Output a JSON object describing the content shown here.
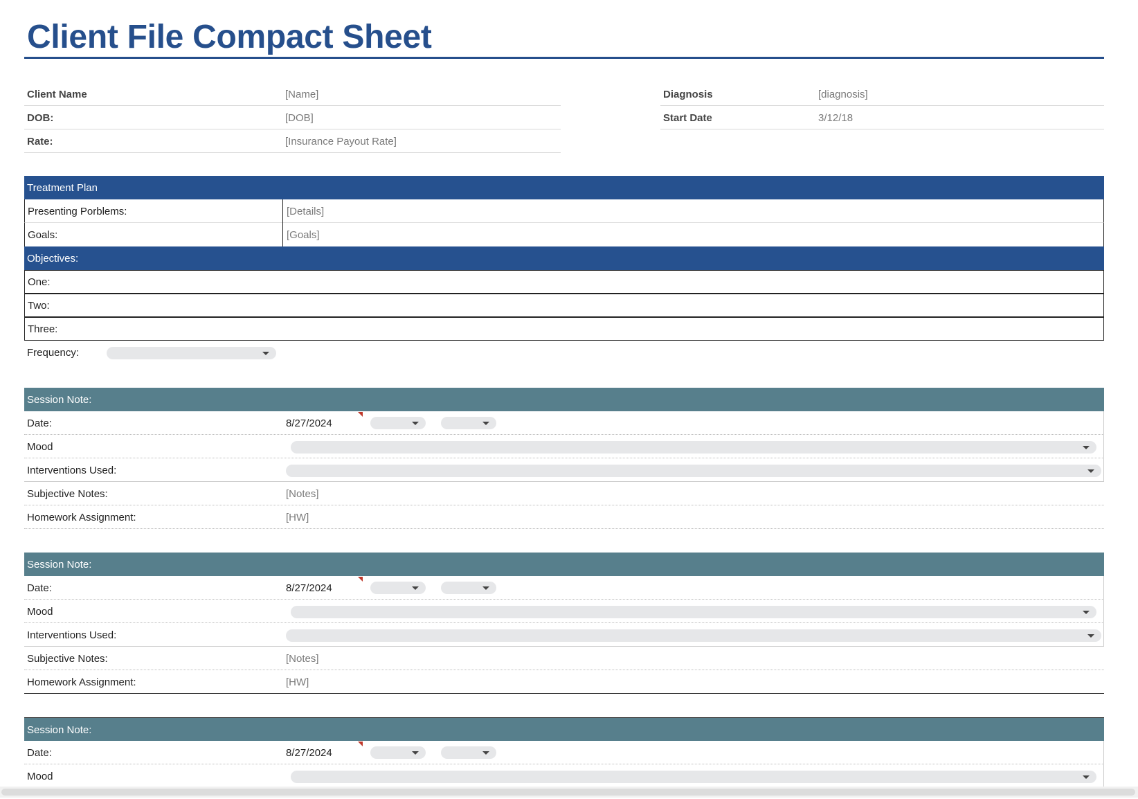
{
  "title": "Client File Compact Sheet",
  "client_info": {
    "left": [
      {
        "label": "Client Name",
        "value": "[Name]"
      },
      {
        "label": "DOB:",
        "value": "[DOB]"
      },
      {
        "label": "Rate:",
        "value": "[Insurance Payout Rate]"
      }
    ],
    "right": [
      {
        "label": "Diagnosis",
        "value": "[diagnosis]"
      },
      {
        "label": "Start Date",
        "value": "3/12/18"
      }
    ]
  },
  "treatment_plan": {
    "header": "Treatment Plan",
    "presenting_label": "Presenting Porblems:",
    "presenting_value": "[Details]",
    "goals_label": "Goals:",
    "goals_value": "[Goals]",
    "objectives_header": "Objectives:",
    "objectives": [
      "One:",
      "Two:",
      "Three:"
    ],
    "frequency_label": "Frequency:",
    "frequency_value": ""
  },
  "session_notes": [
    {
      "header": "Session Note:",
      "date_label": "Date:",
      "date_value": "8/27/2024",
      "mood_label": "Mood",
      "mood_value": "",
      "interventions_label": "Interventions Used:",
      "interventions_value": "",
      "subjective_label": "Subjective Notes:",
      "subjective_value": "[Notes]",
      "homework_label": "Homework Assignment:",
      "homework_value": "[HW]"
    },
    {
      "header": "Session Note:",
      "date_label": "Date:",
      "date_value": "8/27/2024",
      "mood_label": "Mood",
      "mood_value": "",
      "interventions_label": "Interventions Used:",
      "interventions_value": "",
      "subjective_label": "Subjective Notes:",
      "subjective_value": "[Notes]",
      "homework_label": "Homework Assignment:",
      "homework_value": "[HW]"
    },
    {
      "header": "Session Note:",
      "date_label": "Date:",
      "date_value": "8/27/2024",
      "mood_label": "Mood",
      "mood_value": ""
    }
  ],
  "colors": {
    "title_blue": "#264f8c",
    "band_blue": "#26518f",
    "band_teal": "#577f8c",
    "dropdown_fill": "#e6e7e9",
    "comment_marker": "#c0392b"
  },
  "icons": {
    "dropdown": "caret-down-icon",
    "comment": "comment-marker-icon"
  }
}
